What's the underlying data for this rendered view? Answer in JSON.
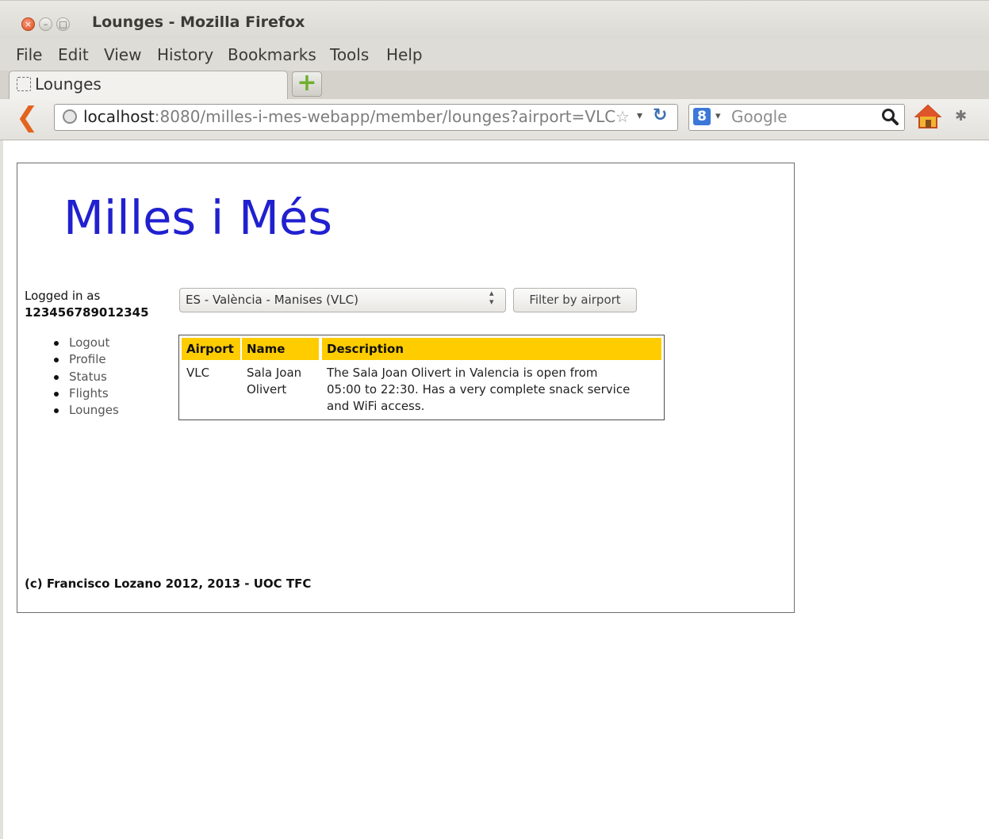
{
  "window": {
    "title": "Lounges - Mozilla Firefox",
    "controls": {
      "close": "×",
      "minimize": "–",
      "maximize": "□"
    }
  },
  "menu": [
    "File",
    "Edit",
    "View",
    "History",
    "Bookmarks",
    "Tools",
    "Help"
  ],
  "tab": {
    "label": "Lounges"
  },
  "newtab": {
    "glyph": "+"
  },
  "address": {
    "host": "localhost",
    "rest": ":8080/milles-i-mes-webapp/member/lounges?airport=VLC"
  },
  "search": {
    "engine_glyph": "8",
    "placeholder": "Google"
  },
  "site": {
    "title": "Milles i Més"
  },
  "user": {
    "logged_label": "Logged in as",
    "id": "123456789012345"
  },
  "nav": [
    "Logout",
    "Profile",
    "Status",
    "Flights",
    "Lounges"
  ],
  "filter": {
    "selected": "ES - València - Manises (VLC)",
    "button": "Filter by airport"
  },
  "table": {
    "headers": [
      "Airport",
      "Name",
      "Description"
    ],
    "rows": [
      {
        "airport": "VLC",
        "name_lines": [
          "Sala Joan",
          "Olivert"
        ],
        "description_lines": [
          "The Sala Joan Olivert in Valencia is open from",
          "05:00 to 22:30. Has a very complete snack service",
          "and WiFi access."
        ]
      }
    ]
  },
  "footer": "(c) Francisco Lozano 2012, 2013 - UOC TFC",
  "colors": {
    "title_blue": "#2020d0",
    "header_yellow": "#ffcc00",
    "back_orange": "#e2631f"
  },
  "icons": [
    "close-icon",
    "minimize-icon",
    "maximize-icon",
    "page-icon",
    "new-tab-icon",
    "back-icon",
    "globe-icon",
    "star-icon",
    "dropdown-icon",
    "reload-icon",
    "google-icon",
    "search-icon",
    "home-icon",
    "extension-icon"
  ]
}
